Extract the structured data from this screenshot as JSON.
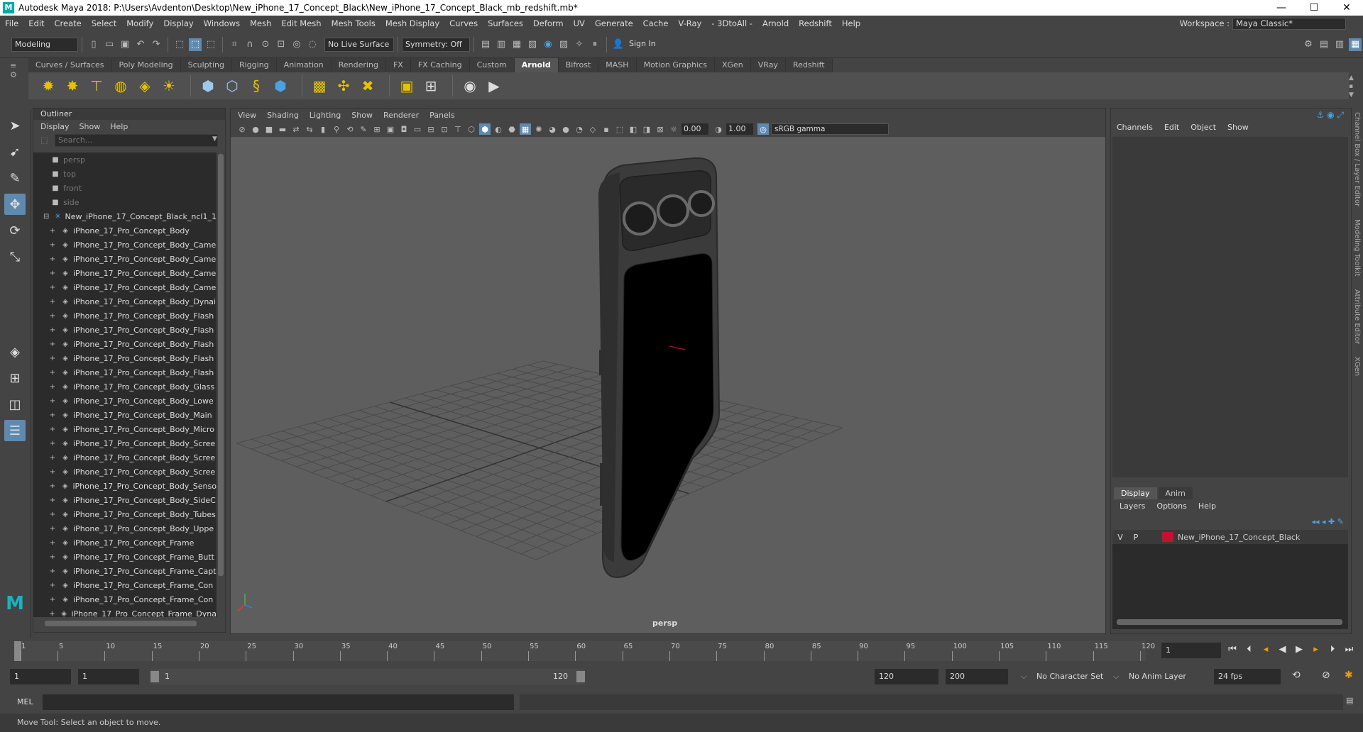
{
  "titlebar": {
    "title": "Autodesk Maya 2018: P:\\Users\\Avdenton\\Desktop\\New_iPhone_17_Concept_Black\\New_iPhone_17_Concept_Black_mb_redshift.mb*",
    "minimize": "—",
    "maximize": "☐",
    "close": "✕"
  },
  "menubar": {
    "items": [
      "File",
      "Edit",
      "Create",
      "Select",
      "Modify",
      "Display",
      "Windows",
      "Mesh",
      "Edit Mesh",
      "Mesh Tools",
      "Mesh Display",
      "Curves",
      "Surfaces",
      "Deform",
      "UV",
      "Generate",
      "Cache",
      "V-Ray",
      "- 3DtoAll -",
      "Arnold",
      "Redshift",
      "Help"
    ],
    "workspace_label": "Workspace :",
    "workspace_value": "Maya Classic*"
  },
  "statusline": {
    "mode": "Modeling",
    "live_surface": "No Live Surface",
    "symmetry": "Symmetry: Off",
    "sign_in": "Sign In"
  },
  "shelf": {
    "tabs": [
      "Curves / Surfaces",
      "Poly Modeling",
      "Sculpting",
      "Rigging",
      "Animation",
      "Rendering",
      "FX",
      "FX Caching",
      "Custom",
      "Arnold",
      "Bifrost",
      "MASH",
      "Motion Graphics",
      "XGen",
      "VRay",
      "Redshift"
    ],
    "active_tab": "Arnold"
  },
  "outliner": {
    "title": "Outliner",
    "menu": [
      "Display",
      "Show",
      "Help"
    ],
    "search_placeholder": "Search...",
    "items": [
      {
        "label": "persp",
        "type": "camera"
      },
      {
        "label": "top",
        "type": "camera"
      },
      {
        "label": "front",
        "type": "camera"
      },
      {
        "label": "side",
        "type": "camera"
      },
      {
        "label": "New_iPhone_17_Concept_Black_ncl1_1",
        "type": "group"
      },
      {
        "label": "iPhone_17_Pro_Concept_Body",
        "type": "mesh"
      },
      {
        "label": "iPhone_17_Pro_Concept_Body_Came",
        "type": "mesh"
      },
      {
        "label": "iPhone_17_Pro_Concept_Body_Came",
        "type": "mesh"
      },
      {
        "label": "iPhone_17_Pro_Concept_Body_Came",
        "type": "mesh"
      },
      {
        "label": "iPhone_17_Pro_Concept_Body_Came",
        "type": "mesh"
      },
      {
        "label": "iPhone_17_Pro_Concept_Body_Dynai",
        "type": "mesh"
      },
      {
        "label": "iPhone_17_Pro_Concept_Body_Flash",
        "type": "mesh"
      },
      {
        "label": "iPhone_17_Pro_Concept_Body_Flash",
        "type": "mesh"
      },
      {
        "label": "iPhone_17_Pro_Concept_Body_Flash",
        "type": "mesh"
      },
      {
        "label": "iPhone_17_Pro_Concept_Body_Flash",
        "type": "mesh"
      },
      {
        "label": "iPhone_17_Pro_Concept_Body_Flash",
        "type": "mesh"
      },
      {
        "label": "iPhone_17_Pro_Concept_Body_Glass",
        "type": "mesh"
      },
      {
        "label": "iPhone_17_Pro_Concept_Body_Lowe",
        "type": "mesh"
      },
      {
        "label": "iPhone_17_Pro_Concept_Body_Main",
        "type": "mesh"
      },
      {
        "label": "iPhone_17_Pro_Concept_Body_Micro",
        "type": "mesh"
      },
      {
        "label": "iPhone_17_Pro_Concept_Body_Scree",
        "type": "mesh"
      },
      {
        "label": "iPhone_17_Pro_Concept_Body_Scree",
        "type": "mesh"
      },
      {
        "label": "iPhone_17_Pro_Concept_Body_Scree",
        "type": "mesh"
      },
      {
        "label": "iPhone_17_Pro_Concept_Body_Senso",
        "type": "mesh"
      },
      {
        "label": "iPhone_17_Pro_Concept_Body_SideC",
        "type": "mesh"
      },
      {
        "label": "iPhone_17_Pro_Concept_Body_Tubes",
        "type": "mesh"
      },
      {
        "label": "iPhone_17_Pro_Concept_Body_Uppe",
        "type": "mesh"
      },
      {
        "label": "iPhone_17_Pro_Concept_Frame",
        "type": "mesh"
      },
      {
        "label": "iPhone_17_Pro_Concept_Frame_Butt",
        "type": "mesh"
      },
      {
        "label": "iPhone_17_Pro_Concept_Frame_Capt",
        "type": "mesh"
      },
      {
        "label": "iPhone_17_Pro_Concept_Frame_Con",
        "type": "mesh"
      },
      {
        "label": "iPhone_17_Pro_Concept_Frame_Con",
        "type": "mesh"
      },
      {
        "label": "iPhone_17_Pro_Concept_Frame_Dyna",
        "type": "mesh"
      }
    ]
  },
  "viewport": {
    "menu": [
      "View",
      "Shading",
      "Lighting",
      "Show",
      "Renderer",
      "Panels"
    ],
    "exposure": "0.00",
    "gamma": "1.00",
    "color_space": "sRGB gamma",
    "camera_label": "persp"
  },
  "channelbox": {
    "menu": [
      "Channels",
      "Edit",
      "Object",
      "Show"
    ],
    "layer_tabs": [
      "Display",
      "Anim"
    ],
    "layer_menu": [
      "Layers",
      "Options",
      "Help"
    ],
    "layer": {
      "v": "V",
      "p": "P",
      "name": "New_iPhone_17_Concept_Black",
      "color": "#c8102e"
    }
  },
  "side_tabs": [
    "Channel Box / Layer Editor",
    "Modeling Toolkit",
    "Attribute Editor",
    "XGen"
  ],
  "timeslider": {
    "ticks": [
      "1",
      "5",
      "10",
      "15",
      "20",
      "25",
      "30",
      "35",
      "40",
      "45",
      "50",
      "55",
      "60",
      "65",
      "70",
      "75",
      "80",
      "85",
      "90",
      "95",
      "100",
      "105",
      "110",
      "115",
      "120"
    ],
    "current_frame": "1"
  },
  "range": {
    "start": "1",
    "playback_start": "1",
    "range_start": "1",
    "range_end": "120",
    "playback_end": "120",
    "end": "200",
    "character_set": "No Character Set",
    "anim_layer": "No Anim Layer",
    "fps": "24 fps"
  },
  "cmdline": {
    "label": "MEL"
  },
  "helpline": {
    "text": "Move Tool: Select an object to move."
  }
}
